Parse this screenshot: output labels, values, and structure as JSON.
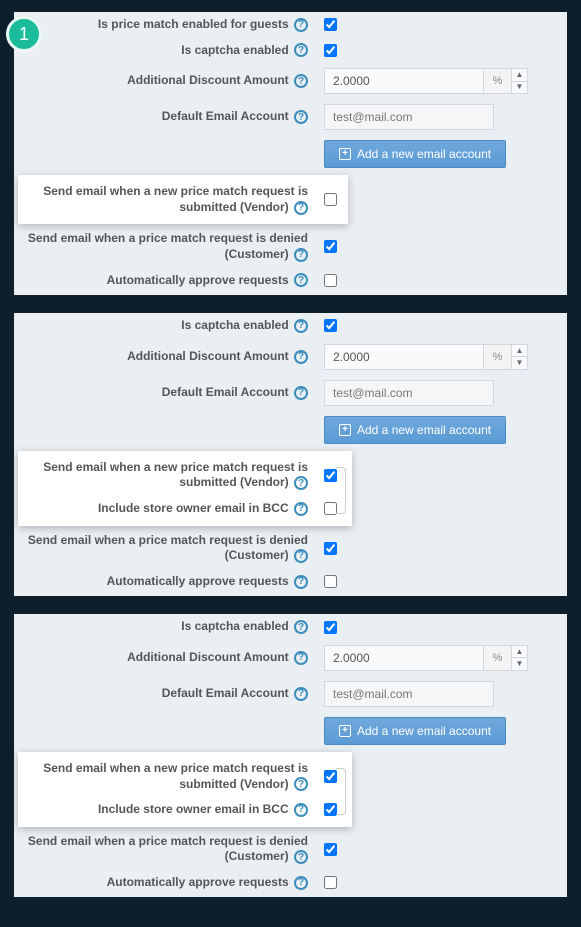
{
  "badge": "1",
  "common": {
    "guests_label": "Is price match enabled for guests",
    "captcha_label": "Is captcha enabled",
    "discount_label": "Additional Discount Amount",
    "discount_value": "2.0000",
    "discount_unit": "%",
    "email_label": "Default Email Account",
    "email_value": "test@mail.com",
    "add_email_btn": "Add a new email account",
    "send_vendor_label": "Send email when a new price match request is submitted (Vendor)",
    "bcc_label": "Include store owner email in BCC",
    "denied_label": "Send email when a price match request is denied (Customer)",
    "auto_label": "Automatically approve requests"
  },
  "panels": {
    "p1": {
      "vendor_checked": false,
      "show_bcc": false,
      "bcc_checked": false
    },
    "p2": {
      "vendor_checked": true,
      "show_bcc": true,
      "bcc_checked": false
    },
    "p3": {
      "vendor_checked": true,
      "show_bcc": true,
      "bcc_checked": true
    }
  }
}
